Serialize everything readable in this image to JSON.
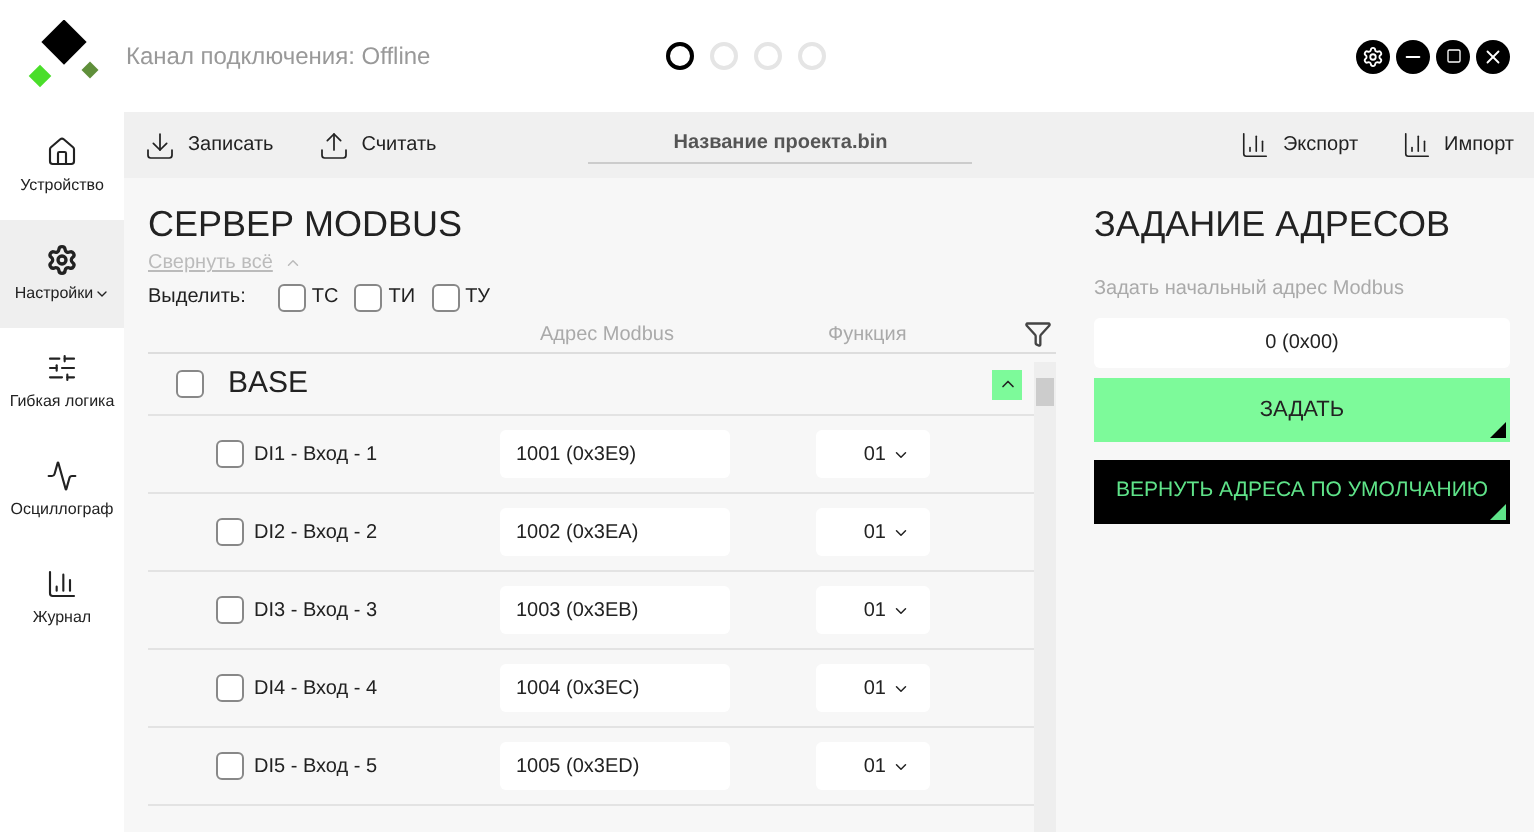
{
  "header": {
    "connection": "Канал подключения: Offline",
    "pages": [
      {
        "selected": true
      },
      {
        "selected": false
      },
      {
        "selected": false
      },
      {
        "selected": false
      }
    ]
  },
  "sidebar": {
    "items": [
      {
        "label": "Устройство",
        "selected": false,
        "dropdown": false
      },
      {
        "label": "Настройки",
        "selected": true,
        "dropdown": true
      },
      {
        "label": "Гибкая логика",
        "selected": false,
        "dropdown": false
      },
      {
        "label": "Осциллограф",
        "selected": false,
        "dropdown": false
      },
      {
        "label": "Журнал",
        "selected": false,
        "dropdown": false
      }
    ]
  },
  "toolbar": {
    "write": "Записать",
    "read": "Считать",
    "project": "Название проекта.bin",
    "export": "Экспорт",
    "import": "Импорт"
  },
  "server": {
    "title": "СЕРВЕР MODBUS",
    "collapse": "Свернуть всё",
    "select_label": "Выделить:",
    "select": [
      {
        "label": "ТС",
        "checked": false
      },
      {
        "label": "ТИ",
        "checked": false
      },
      {
        "label": "ТУ",
        "checked": false
      }
    ],
    "columns": [
      "Адрес Modbus",
      "Функция"
    ],
    "group": {
      "name": "BASE",
      "checked": false,
      "expanded": true
    },
    "rows": [
      {
        "name": "DI1 - Вход - 1",
        "checked": false,
        "address": "1001 (0x3E9)",
        "function": "01"
      },
      {
        "name": "DI2 - Вход - 2",
        "checked": false,
        "address": "1002 (0x3EA)",
        "function": "01"
      },
      {
        "name": "DI3 - Вход - 3",
        "checked": false,
        "address": "1003 (0x3EB)",
        "function": "01"
      },
      {
        "name": "DI4 - Вход - 4",
        "checked": false,
        "address": "1004 (0x3EC)",
        "function": "01"
      },
      {
        "name": "DI5 - Вход - 5",
        "checked": false,
        "address": "1005 (0x3ED)",
        "function": "01"
      }
    ]
  },
  "addressing": {
    "title": "ЗАДАНИЕ АДРЕСОВ",
    "label": "Задать начальный адрес Modbus",
    "value": "0 (0x00)",
    "set_button": "ЗАДАТЬ",
    "reset_button": "ВЕРНУТЬ АДРЕСА ПО УМОЛЧАНИЮ"
  }
}
